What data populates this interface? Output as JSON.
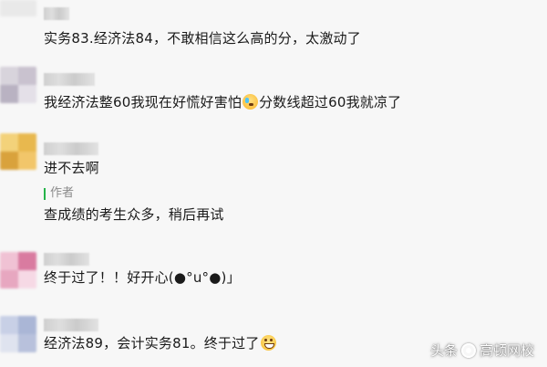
{
  "comments": [
    {
      "text": "实务83.经济法84，不敢相信这么高的分，太激动了"
    },
    {
      "text_before": "我经济法整60我现在好慌好害怕",
      "emoji": "scared-face-emoji",
      "text_after": "分数线超过60我就凉了"
    },
    {
      "text": "进不去啊",
      "reply": {
        "label": "作者",
        "text": "查成绩的考生众多，稍后再试"
      }
    },
    {
      "text": "终于过了！！好开心(●°u°●)」"
    },
    {
      "text_before": "经济法89，会计实务81。终于过了",
      "emoji": "grinning-face-emoji"
    }
  ],
  "watermark": {
    "left": "头条",
    "right": "高顿网校"
  }
}
